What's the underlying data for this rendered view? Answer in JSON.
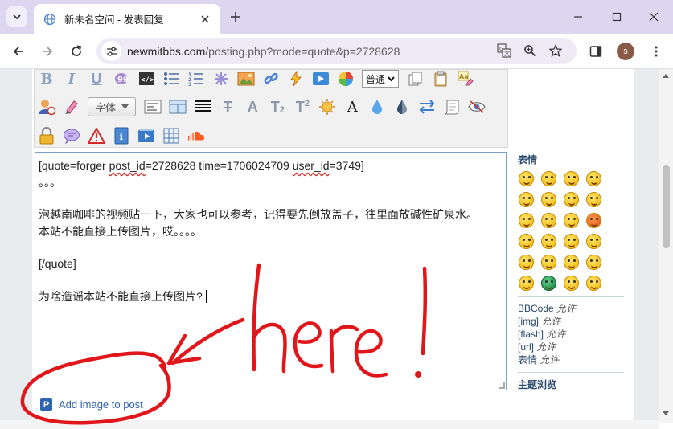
{
  "browser": {
    "tab_title": "新未名空间 - 发表回复",
    "url_domain": "newmitbbs.com",
    "url_path": "/posting.php?mode=quote&p=2728628",
    "profile_initial": "s"
  },
  "editor": {
    "size_select": "普通",
    "font_button": "字体",
    "content": {
      "line1_prefix": "[quote=forger ",
      "line1_post_id": "post_id",
      "line1_middle": "=2728628 time=1706024709 ",
      "line1_user_id": "user_id",
      "line1_suffix": "=3749]",
      "line2": "。。。",
      "line3": "泡越南咖啡的视频贴一下，大家也可以参考，记得要先倒放盖子，往里面放碱性矿泉水。",
      "line4": "本站不能直接上传图片，哎。。。。",
      "line5": "[/quote]",
      "line6": "为啥造谣本站不能直接上传图片?"
    }
  },
  "sidebar": {
    "smilies_heading": "表情",
    "permissions": [
      {
        "name": "BBCode",
        "status": "允许"
      },
      {
        "name": "[img]",
        "status": "允许"
      },
      {
        "name": "[flash]",
        "status": "允许"
      },
      {
        "name": "[url]",
        "status": "允许"
      },
      {
        "name": "表情",
        "status": "允许"
      }
    ],
    "topic_review": "主题浏览"
  },
  "add_image": {
    "label": "Add image to post"
  },
  "annotation": {
    "text": "here !",
    "color": "#e0161b"
  }
}
